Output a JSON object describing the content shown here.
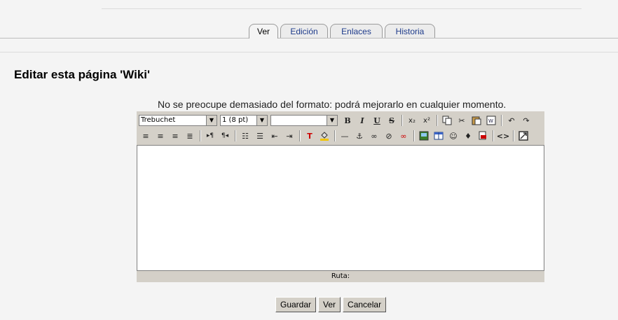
{
  "tabs": [
    {
      "label": "Ver",
      "active": true
    },
    {
      "label": "Edición",
      "active": false
    },
    {
      "label": "Enlaces",
      "active": false
    },
    {
      "label": "Historia",
      "active": false
    }
  ],
  "page_title": "Editar esta página 'Wiki'",
  "format_hint": "No se preocupe demasiado del formato: podrá mejorarlo en cualquier momento.",
  "editor": {
    "font_select": "Trebuchet",
    "size_select": "1 (8 pt)",
    "style_select": "",
    "path_label": "Ruta:"
  },
  "buttons": {
    "save": "Guardar",
    "preview": "Ver",
    "cancel": "Cancelar"
  }
}
